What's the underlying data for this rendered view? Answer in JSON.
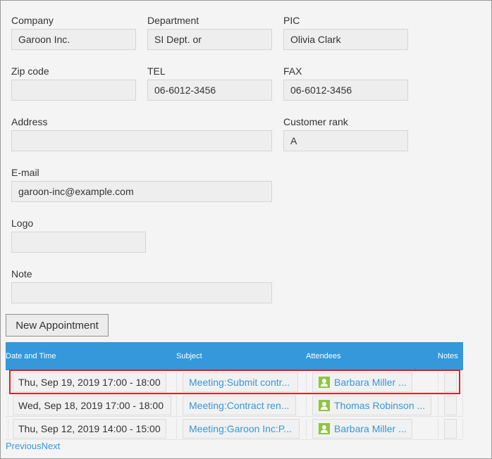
{
  "form": {
    "company": {
      "label": "Company",
      "value": "Garoon Inc."
    },
    "department": {
      "label": "Department",
      "value": "SI Dept. or"
    },
    "pic": {
      "label": "PIC",
      "value": "Olivia Clark"
    },
    "zip": {
      "label": "Zip code",
      "value": ""
    },
    "tel": {
      "label": "TEL",
      "value": "06-6012-3456"
    },
    "fax": {
      "label": "FAX",
      "value": "06-6012-3456"
    },
    "address": {
      "label": "Address",
      "value": ""
    },
    "rank": {
      "label": "Customer rank",
      "value": "A"
    },
    "email": {
      "label": "E-mail",
      "value": "garoon-inc@example.com"
    },
    "logo": {
      "label": "Logo",
      "value": ""
    },
    "note": {
      "label": "Note",
      "value": ""
    }
  },
  "new_appointment_label": "New Appointment",
  "table": {
    "headers": {
      "date": "Date and Time",
      "subject": "Subject",
      "attendees": "Attendees",
      "notes": "Notes"
    },
    "rows": [
      {
        "date": "Thu, Sep 19, 2019 17:00 - 18:00",
        "subject": "Meeting:Submit contr...",
        "attendee": "Barbara Miller ..."
      },
      {
        "date": "Wed, Sep 18, 2019 17:00 - 18:00",
        "subject": "Meeting:Contract ren...",
        "attendee": "Thomas Robinson ..."
      },
      {
        "date": "Thu, Sep 12, 2019 14:00 - 15:00",
        "subject": "Meeting:Garoon Inc:P...",
        "attendee": "Barbara Miller ..."
      }
    ]
  },
  "pager": {
    "previous": "Previous",
    "next": "Next"
  },
  "colors": {
    "accent": "#3498db",
    "user_icon": "#8cc63f",
    "highlight": "#e02020"
  }
}
